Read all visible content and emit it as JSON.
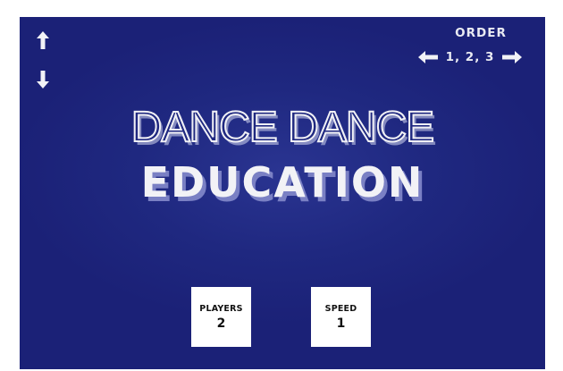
{
  "controls": {
    "up_icon": "up-arrow-icon",
    "down_icon": "down-arrow-icon"
  },
  "order": {
    "label": "ORDER",
    "value": "1, 2, 3",
    "left_icon": "left-arrow-icon",
    "right_icon": "right-arrow-icon"
  },
  "title": {
    "line1": "DANCE DANCE",
    "line2": "EDUCATION"
  },
  "settings": {
    "players": {
      "label": "PLAYERS",
      "value": "2"
    },
    "speed": {
      "label": "SPEED",
      "value": "1"
    }
  },
  "colors": {
    "background": "#1f2880",
    "text": "#e9eaf2",
    "card": "#ffffff"
  }
}
